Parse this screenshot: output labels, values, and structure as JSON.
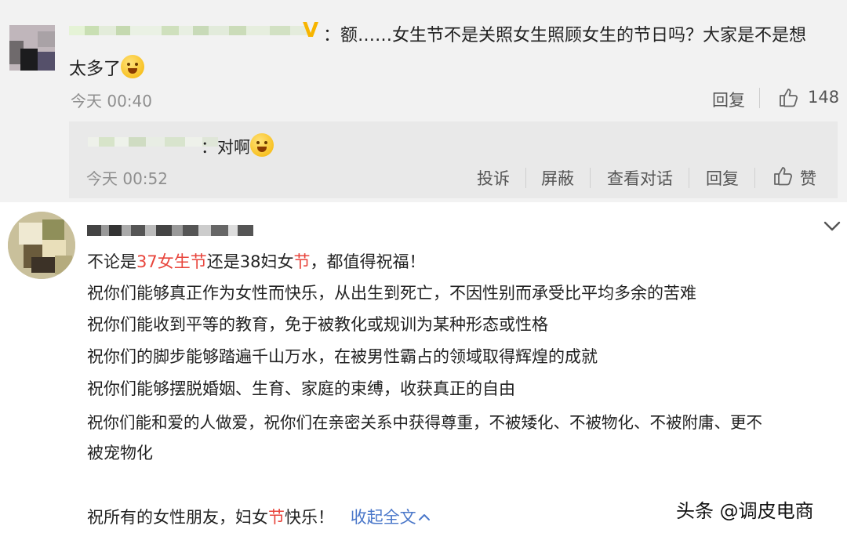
{
  "comment_top": {
    "name_blurred": "",
    "vip_mark": "V",
    "text_line1": "：额……女生节不是关照女生照顾女生的节日吗？大家是不是想",
    "text_line2": "太多了",
    "emoji": "laugh-cry-emoji",
    "time": "今天 00:40",
    "reply_label": "回复",
    "like_count": "148"
  },
  "reply": {
    "text": "：对啊",
    "emoji": "crying-emoji",
    "time": "今天 00:52",
    "actions": [
      "投诉",
      "屏蔽",
      "查看对话",
      "回复",
      "赞"
    ]
  },
  "comment_bottom": {
    "line1_a": "不论是",
    "line1_red1": "37女生",
    "line1_red2": "节",
    "line1_b": "还是38妇女",
    "line1_red3": "节",
    "line1_c": "，都值得祝福！",
    "line2": "祝你们能够真正作为女性而快乐，从出生到死亡，不因性别而承受比平均多余的苦难",
    "line3": "祝你们能收到平等的教育，免于被教化或规训为某种形态或性格",
    "line4": "祝你们的脚步能够踏遍千山万水，在被男性霸占的领域取得辉煌的成就",
    "line5": "祝你们能够摆脱婚姻、生育、家庭的束缚，收获真正的自由",
    "line6": "祝你们能和爱的人做爱，祝你们在亲密关系中获得尊重，不被矮化、不被物化、不被附庸、更不",
    "line7": "被宠物化",
    "line8_a": "祝所有的女性朋友，妇女",
    "line8_red": "节",
    "line8_b": "快乐！",
    "collapse_label": "收起全文",
    "collapse_icon": "chevron-up-icon",
    "expand_icon": "chevron-down-icon"
  },
  "watermark": "头条 @调皮电商"
}
